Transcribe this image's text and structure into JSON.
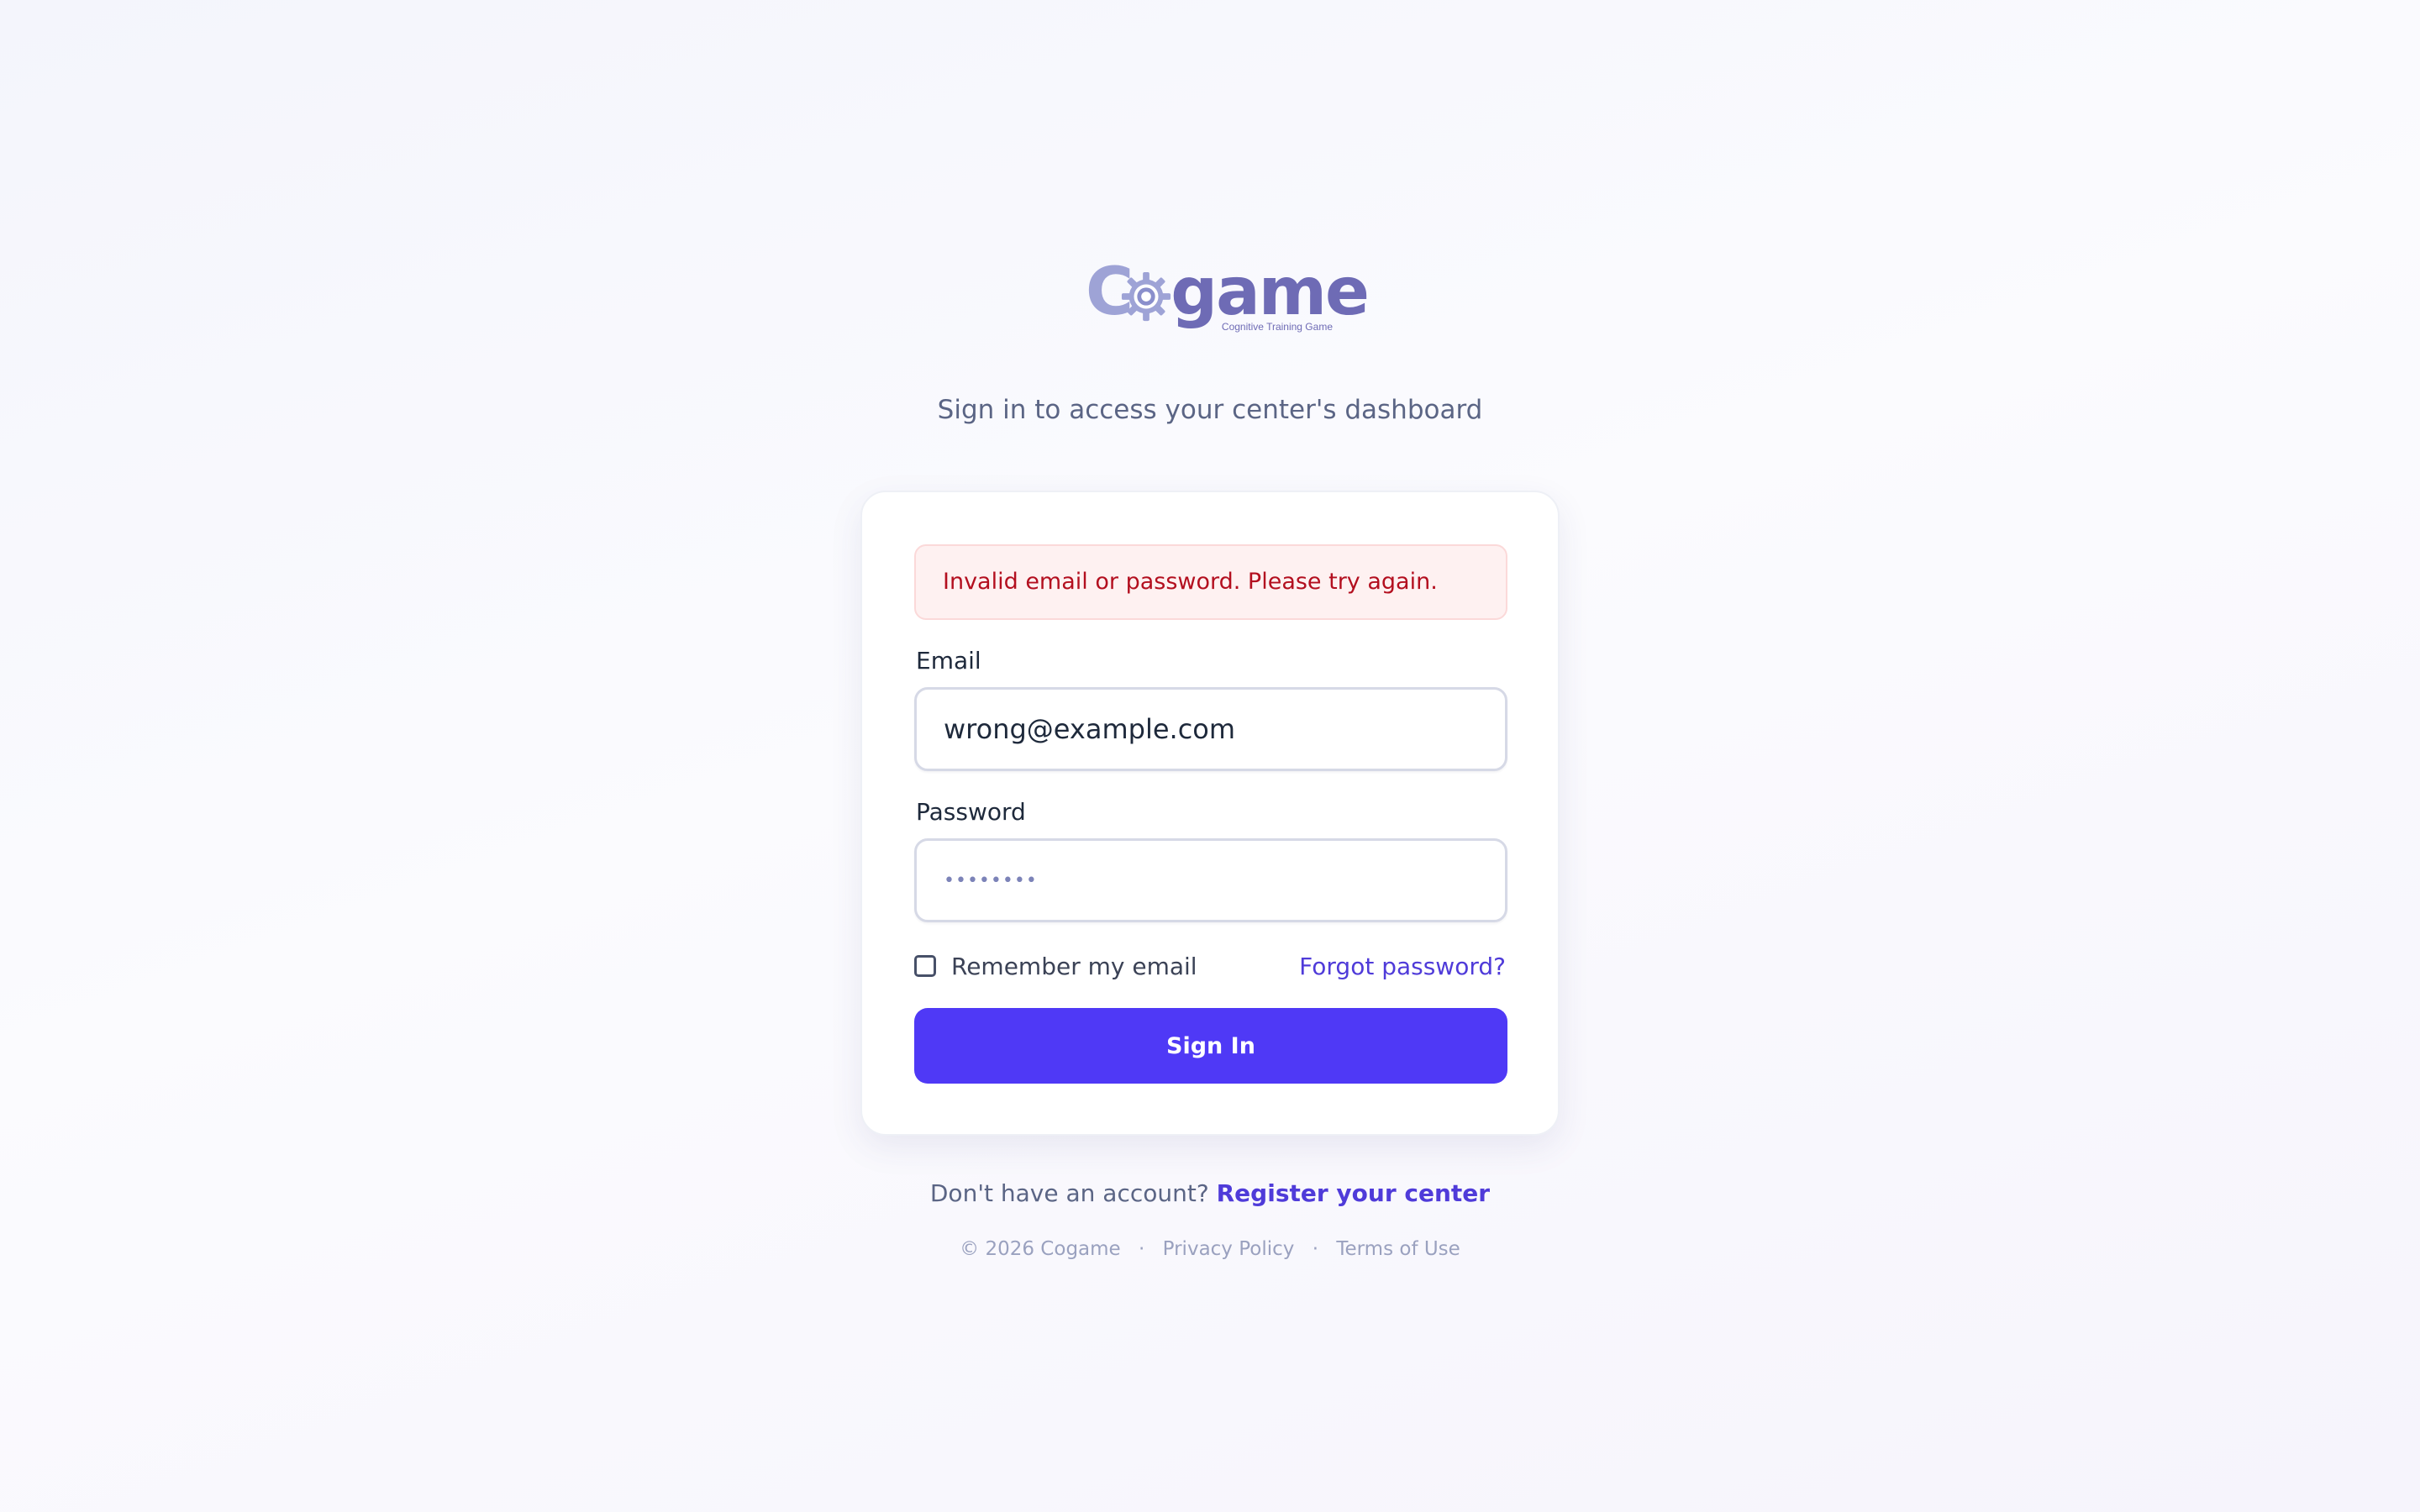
{
  "logo": {
    "prefix": "C",
    "suffix": "game",
    "tagline": "Cognitive Training Game"
  },
  "subtitle": "Sign in to access your center's dashboard",
  "alert": {
    "message": "Invalid email or password. Please try again."
  },
  "form": {
    "email_label": "Email",
    "email_value": "wrong@example.com",
    "password_label": "Password",
    "password_value": "••••••••",
    "remember_label": "Remember my email",
    "remember_checked": false,
    "forgot_label": "Forgot password?",
    "submit_label": "Sign In"
  },
  "register": {
    "prompt": "Don't have an account?",
    "link": "Register your center"
  },
  "footer": {
    "copyright": "© 2026 Cogame",
    "separator": "·",
    "privacy": "Privacy Policy",
    "terms": "Terms of Use"
  },
  "colors": {
    "primary": "#4f39f6",
    "link": "#4f3bd9",
    "error_text": "#b30f1f",
    "error_bg": "#fef1f1",
    "logo_light": "#9ea3d6",
    "logo_dark": "#6e6bb5"
  }
}
